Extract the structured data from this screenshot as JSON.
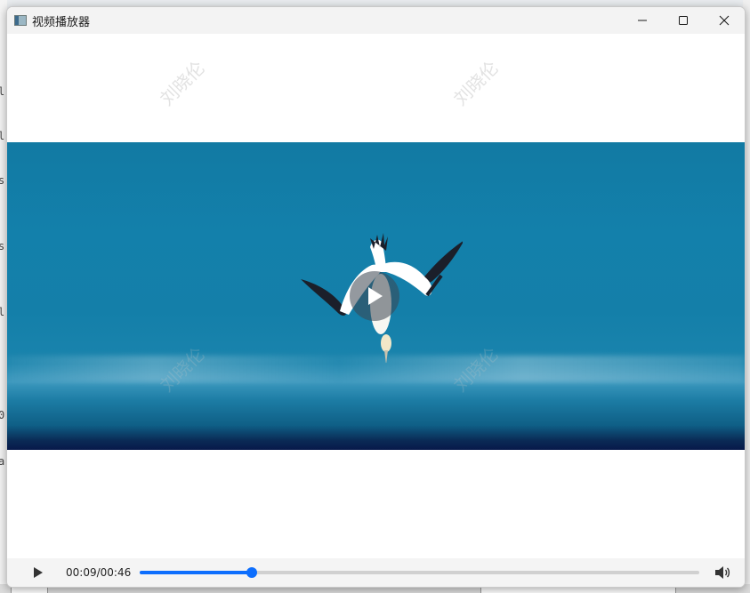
{
  "window": {
    "title": "视频播放器"
  },
  "watermark": {
    "text": "刘晓伦"
  },
  "player": {
    "current_time": "00:09",
    "duration": "00:46",
    "time_display": "00:09/00:46",
    "progress_fraction": 0.2,
    "state": "paused"
  },
  "icons": {
    "app": "app-icon",
    "minimize": "minimize-icon",
    "maximize": "maximize-icon",
    "close": "close-icon",
    "play": "play-icon",
    "volume": "volume-icon"
  },
  "colors": {
    "accent": "#0d6efd",
    "video_sea": "#147fa9"
  }
}
